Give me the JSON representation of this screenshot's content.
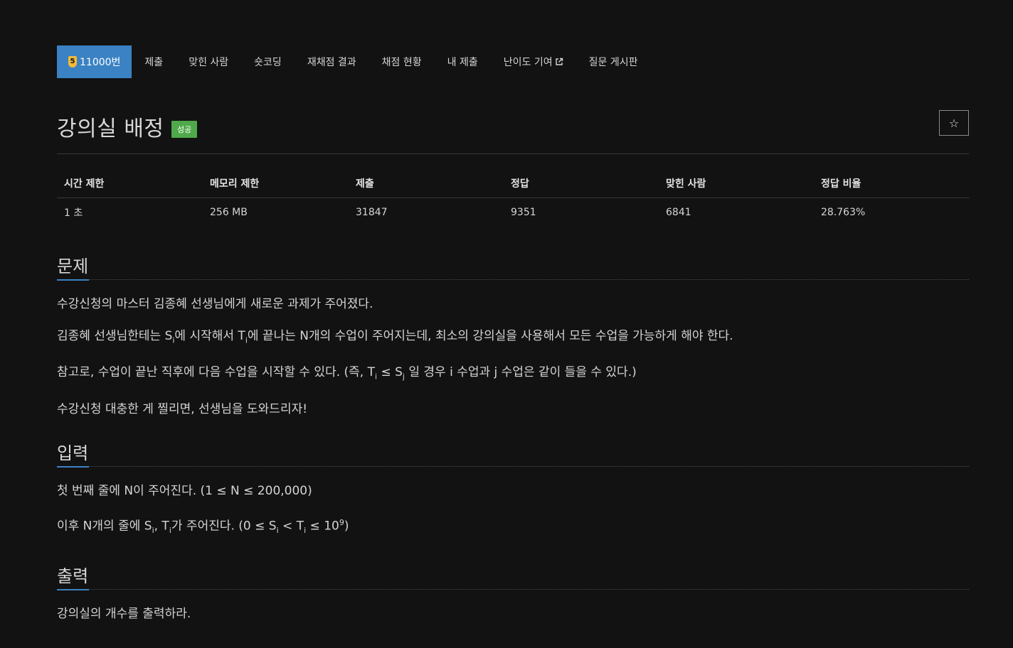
{
  "nav": {
    "tier": "5",
    "tabs": [
      {
        "label": "11000번"
      },
      {
        "label": "제출"
      },
      {
        "label": "맞힌 사람"
      },
      {
        "label": "숏코딩"
      },
      {
        "label": "재채점 결과"
      },
      {
        "label": "채점 현황"
      },
      {
        "label": "내 제출"
      },
      {
        "label": "난이도 기여"
      },
      {
        "label": "질문 게시판"
      }
    ]
  },
  "problem": {
    "title": "강의실 배정",
    "status": "성공",
    "star": "☆"
  },
  "info": {
    "headers": [
      "시간 제한",
      "메모리 제한",
      "제출",
      "정답",
      "맞힌 사람",
      "정답 비율"
    ],
    "values": [
      "1 초",
      "256 MB",
      "31847",
      "9351",
      "6841",
      "28.763%"
    ]
  },
  "sections": {
    "description": {
      "heading": "문제",
      "p1": "수강신청의 마스터 김종혜 선생님에게 새로운 과제가 주어졌다.",
      "p2_a": "김종혜 선생님한테는 S",
      "p2_sub1": "i",
      "p2_b": "에 시작해서 T",
      "p2_sub2": "i",
      "p2_c": "에 끝나는 N개의 수업이 주어지는데, 최소의 강의실을 사용해서 모든 수업을 가능하게 해야 한다.",
      "p3_a": "참고로, 수업이 끝난 직후에 다음 수업을 시작할 수 있다. (즉, T",
      "p3_sub1": "i",
      "p3_b": " ≤ S",
      "p3_sub2": "j",
      "p3_c": " 일 경우 i 수업과 j 수업은 같이 들을 수 있다.)",
      "p4": "수강신청 대충한 게 찔리면, 선생님을 도와드리자!"
    },
    "input": {
      "heading": "입력",
      "p1": "첫 번째 줄에 N이 주어진다. (1 ≤ N ≤ 200,000)",
      "p2_a": "이후 N개의 줄에 S",
      "p2_sub1": "i",
      "p2_b": ", T",
      "p2_sub2": "i",
      "p2_c": "가 주어진다. (0 ≤ S",
      "p2_sub3": "i",
      "p2_d": " < T",
      "p2_sub4": "i",
      "p2_e": " ≤ 10",
      "p2_sup": "9",
      "p2_f": ")"
    },
    "output": {
      "heading": "출력",
      "p1": "강의실의 개수를 출력하라."
    }
  }
}
